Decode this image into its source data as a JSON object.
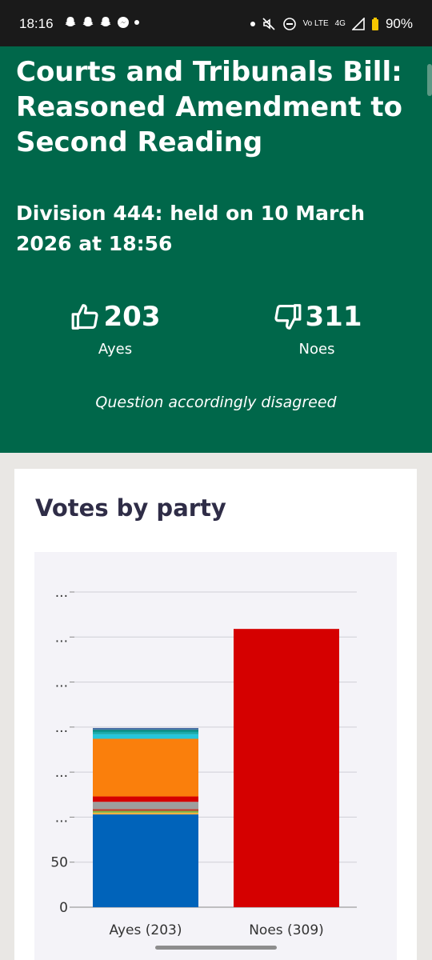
{
  "status_bar": {
    "time": "18:16",
    "network": "4G",
    "lte": "Vo LTE",
    "battery": "90%"
  },
  "division": {
    "title": "Courts and Tribunals Bill: Reasoned Amendment to Second Reading",
    "subtitle": "Division 444: held on 10 March 2026 at 18:56",
    "ayes": {
      "count": "203",
      "label": "Ayes"
    },
    "noes": {
      "count": "311",
      "label": "Noes"
    },
    "outcome": "Question accordingly disagreed"
  },
  "colors": {
    "hero_bg": "#00674a",
    "labour_red": "#d50000",
    "conservative_blue": "#0063ba",
    "libdem_orange": "#fa7f0c",
    "teal": "#1aaaaa"
  },
  "votes_by_party": {
    "heading": "Votes by party"
  },
  "chart_data": {
    "type": "bar",
    "stacked": true,
    "title": "Votes by party",
    "categories": [
      "Ayes (203)",
      "Noes (309)"
    ],
    "y_tick_labels": [
      "0",
      "50",
      "...",
      "...",
      "...",
      "...",
      "...",
      "..."
    ],
    "ylim": [
      0,
      350
    ],
    "grid": true,
    "segments": [
      {
        "color": "#0063ba",
        "values": [
          103,
          0
        ]
      },
      {
        "color": "#f5b041",
        "values": [
          2,
          0
        ]
      },
      {
        "color": "#7cb342",
        "values": [
          2,
          0
        ]
      },
      {
        "color": "#c0392b",
        "values": [
          2,
          0
        ]
      },
      {
        "color": "#9e9e9e",
        "values": [
          8,
          0
        ]
      },
      {
        "color": "#d50000",
        "values": [
          6,
          309
        ]
      },
      {
        "color": "#fa7f0c",
        "values": [
          64,
          0
        ]
      },
      {
        "color": "#26c6da",
        "values": [
          5,
          0
        ]
      },
      {
        "color": "#1aaaaa",
        "values": [
          3,
          0
        ]
      },
      {
        "color": "#00897b",
        "values": [
          2,
          0
        ]
      },
      {
        "color": "#4a6fa5",
        "values": [
          2,
          0
        ]
      }
    ]
  }
}
